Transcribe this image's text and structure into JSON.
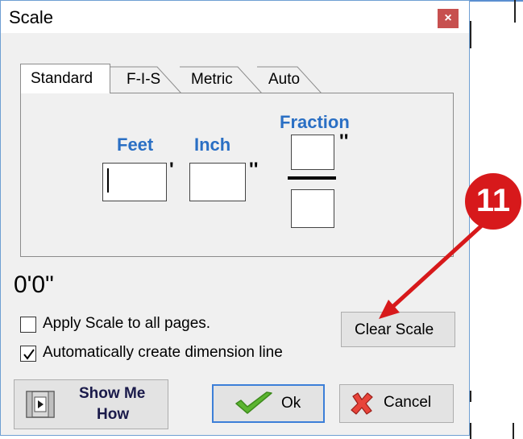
{
  "window": {
    "title": "Scale",
    "close_glyph": "×"
  },
  "tabs": [
    {
      "label": "Standard",
      "active": true
    },
    {
      "label": "F-I-S",
      "active": false
    },
    {
      "label": "Metric",
      "active": false
    },
    {
      "label": "Auto",
      "active": false
    }
  ],
  "standard": {
    "feet_label": "Feet",
    "inch_label": "Inch",
    "fraction_label": "Fraction",
    "feet_value": "",
    "inch_value": "",
    "fraction_numerator": "",
    "fraction_denominator": "",
    "feet_mark": "'",
    "inch_mark": "''",
    "fraction_mark": "''"
  },
  "readout": "0'0\"",
  "options": {
    "apply_all_pages": {
      "label": "Apply Scale to all pages.",
      "checked": false
    },
    "auto_dimension": {
      "label": "Automatically create dimension line",
      "checked": true
    }
  },
  "buttons": {
    "clear_scale": "Clear Scale",
    "show_me_how": [
      "Show Me",
      "How"
    ],
    "ok": "Ok",
    "cancel": "Cancel"
  },
  "annotation": {
    "number": "11",
    "color": "#d7191b"
  },
  "colors": {
    "accent_label": "#2a6fc4",
    "close_button": "#c7504f",
    "frame": "#6f9fd3"
  },
  "icons": [
    "close-icon",
    "film-play-icon",
    "check-icon",
    "x-cancel-icon",
    "callout-arrow"
  ]
}
